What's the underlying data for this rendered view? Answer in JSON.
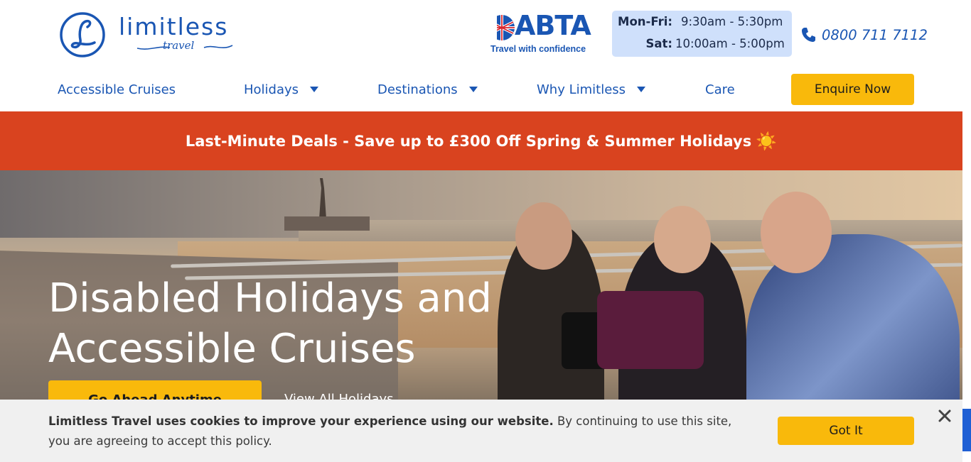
{
  "brand": {
    "logo_text": "limitless",
    "logo_sub": "travel",
    "accent_color": "#1a56b3",
    "cta_color": "#f9b90b"
  },
  "abta": {
    "word": "ABTA",
    "tagline": "Travel with confidence"
  },
  "hours": {
    "weekday_label": "Mon-Fri:",
    "weekday_time": "9:30am - 5:30pm",
    "saturday_label": "Sat:",
    "saturday_time": "10:00am - 5:00pm"
  },
  "phone": {
    "icon": "phone-icon",
    "number": "0800 711 7112"
  },
  "nav": {
    "items": [
      {
        "label": "Accessible Cruises",
        "has_dropdown": false
      },
      {
        "label": "Holidays",
        "has_dropdown": true
      },
      {
        "label": "Destinations",
        "has_dropdown": true
      },
      {
        "label": "Why Limitless",
        "has_dropdown": true
      },
      {
        "label": "Care",
        "has_dropdown": false
      }
    ],
    "enquire_label": "Enquire Now"
  },
  "promo": {
    "text": "Last-Minute Deals - Save up to £300 Off Spring & Summer Holidays",
    "icon": "☀️",
    "color": "#d9431f"
  },
  "hero": {
    "title_line1": "Disabled Holidays and",
    "title_line2": "Accessible Cruises",
    "primary_button": "Go Ahead Anytime",
    "secondary_link": "View All Holidays"
  },
  "cookie": {
    "bold_text": "Limitless Travel uses cookies to improve your experience using our website.",
    "text": " By continuing to use this site, you are agreeing to accept this policy.",
    "button": "Got It"
  }
}
